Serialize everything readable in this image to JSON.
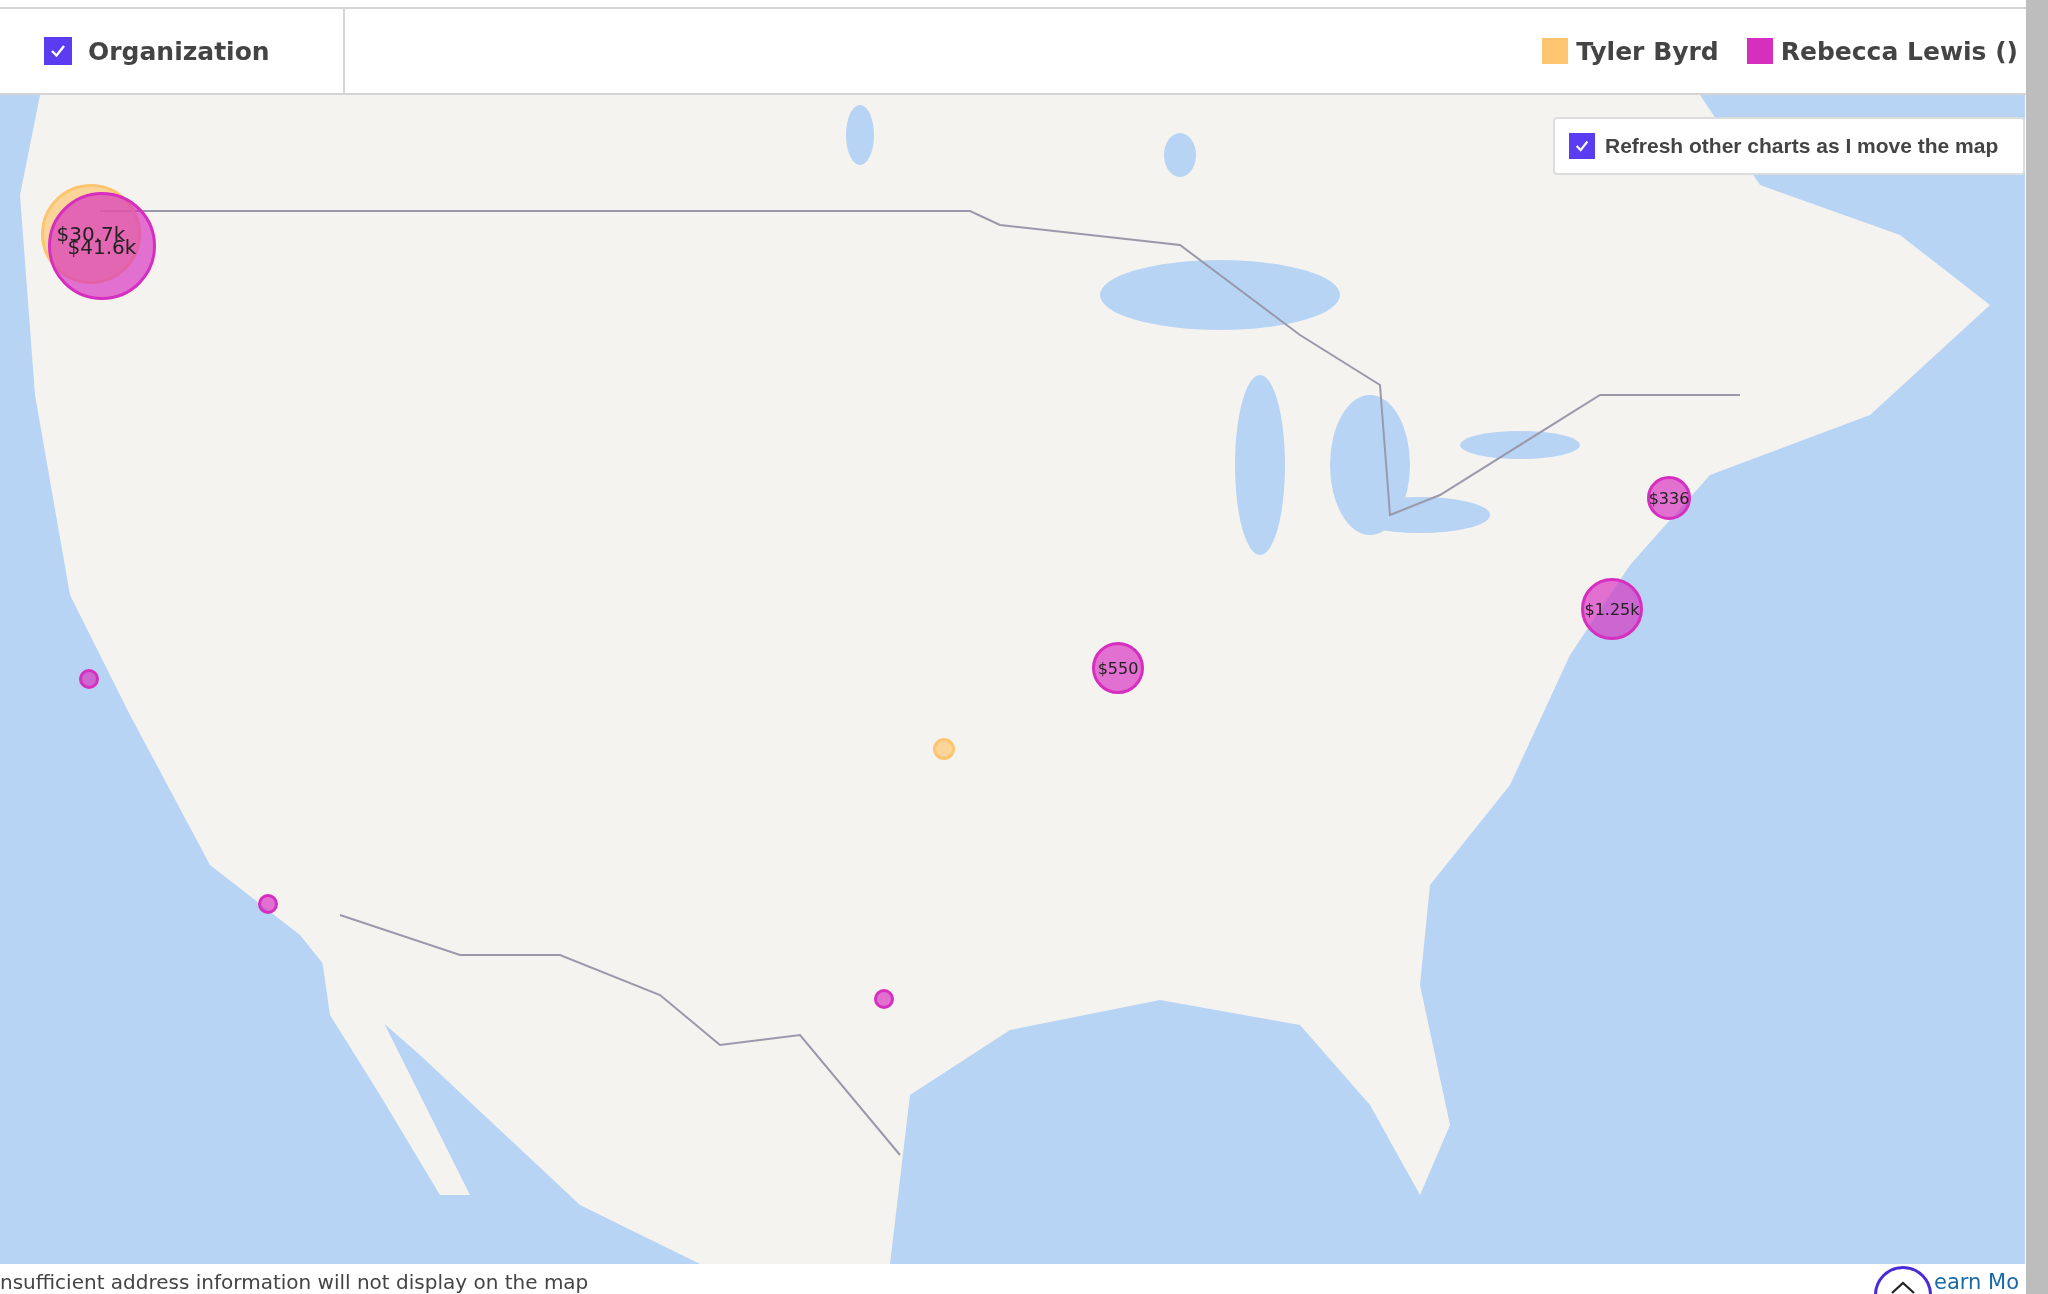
{
  "filter": {
    "label": "Organization",
    "checked": true
  },
  "legend": [
    {
      "label": "Tyler Byrd",
      "color": "#fdc56f"
    },
    {
      "label": "Rebecca Lewis ()",
      "color": "#d62fc0"
    }
  ],
  "map": {
    "kind": "picture",
    "refresh_option": {
      "label": "Refresh other charts as I move the map",
      "checked": true
    },
    "bubbles": [
      {
        "color": "#fdc56f",
        "label": "$30.7k"
      },
      {
        "color": "#d62fc0",
        "label": "$41.6k"
      },
      {
        "color": "#d62fc0"
      },
      {
        "color": "#d62fc0"
      },
      {
        "color": "#d62fc0"
      },
      {
        "color": "#fdc56f"
      },
      {
        "color": "#d62fc0",
        "label": "$550"
      },
      {
        "color": "#d62fc0",
        "label": "$1.25k"
      },
      {
        "color": "#d62fc0",
        "label": "$336"
      }
    ]
  },
  "footer": {
    "note": "nsufficient address information will not display on the map",
    "link": "earn Mo"
  }
}
